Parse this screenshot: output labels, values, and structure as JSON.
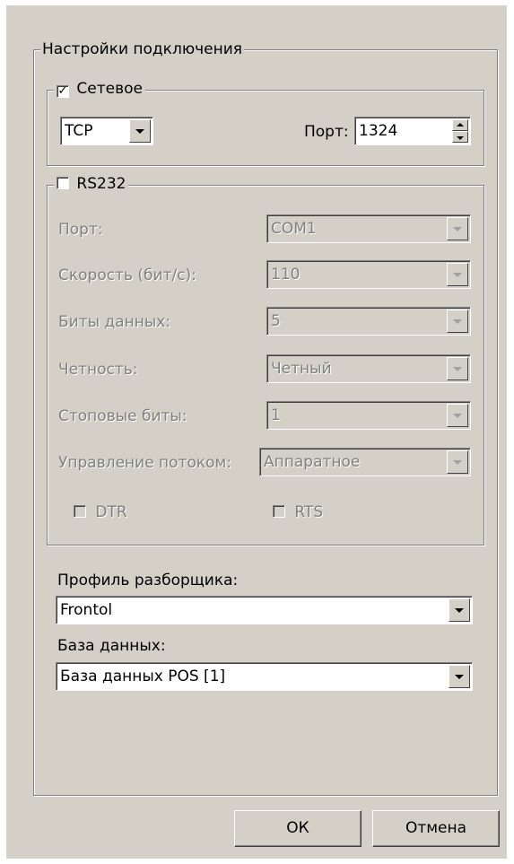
{
  "connection_group": {
    "title": "Настройки подключения"
  },
  "network": {
    "checkbox_label": "Сетевое",
    "checked": true,
    "protocol": "TCP",
    "port_label": "Порт:",
    "port_value": "1324"
  },
  "rs232": {
    "checkbox_label": "RS232",
    "checked": false,
    "fields": [
      {
        "label": "Порт:",
        "value": "COM1"
      },
      {
        "label": "Скорость (бит/с):",
        "value": "110"
      },
      {
        "label": "Биты данных:",
        "value": "5"
      },
      {
        "label": "Четность:",
        "value": "Четный"
      },
      {
        "label": "Стоповые биты:",
        "value": "1"
      },
      {
        "label": "Управление потоком:",
        "value": "Аппаратное"
      }
    ],
    "dtr_label": "DTR",
    "rts_label": "RTS"
  },
  "parser_profile": {
    "label": "Профиль разборщика:",
    "value": "Frontol"
  },
  "database": {
    "label": "База данных:",
    "value": "База данных POS [1]"
  },
  "buttons": {
    "ok": "ОК",
    "cancel": "Отмена"
  }
}
